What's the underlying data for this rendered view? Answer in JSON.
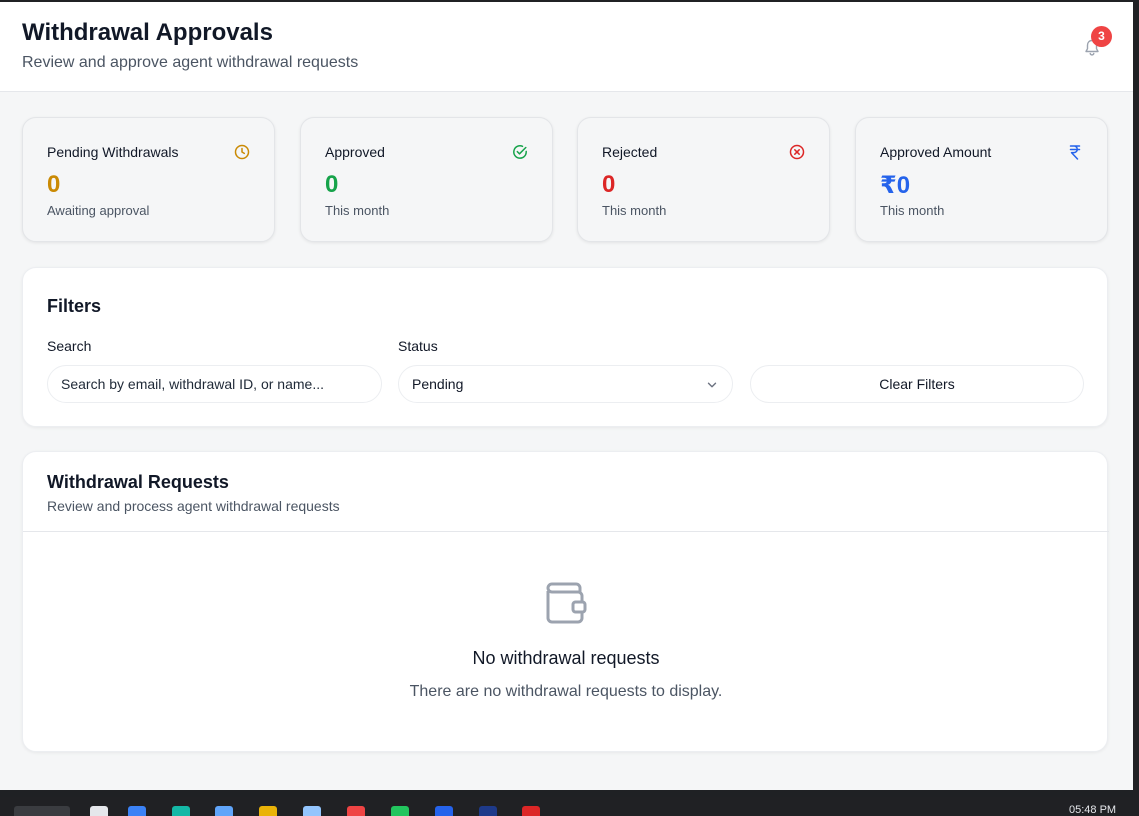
{
  "header": {
    "title": "Withdrawal Approvals",
    "subtitle": "Review and approve agent withdrawal requests",
    "notification_count": "3",
    "notification_icon": "bell-icon"
  },
  "stats": [
    {
      "label": "Pending Withdrawals",
      "value": "0",
      "caption": "Awaiting approval",
      "icon": "clock-icon",
      "color": "#ca8a04"
    },
    {
      "label": "Approved",
      "value": "0",
      "caption": "This month",
      "icon": "check-circle-icon",
      "color": "#16a34a"
    },
    {
      "label": "Rejected",
      "value": "0",
      "caption": "This month",
      "icon": "x-circle-icon",
      "color": "#dc2626"
    },
    {
      "label": "Approved Amount",
      "value": "₹0",
      "caption": "This month",
      "icon": "rupee-icon",
      "color": "#2563eb"
    }
  ],
  "filters": {
    "title": "Filters",
    "search_label": "Search",
    "search_placeholder": "Search by email, withdrawal ID, or name...",
    "status_label": "Status",
    "status_value": "Pending",
    "clear_label": "Clear Filters"
  },
  "requests": {
    "title": "Withdrawal Requests",
    "subtitle": "Review and process agent withdrawal requests",
    "empty_icon": "wallet-icon",
    "empty_title": "No withdrawal requests",
    "empty_text": "There are no withdrawal requests to display."
  },
  "taskbar": {
    "clock": "05:48 PM"
  }
}
